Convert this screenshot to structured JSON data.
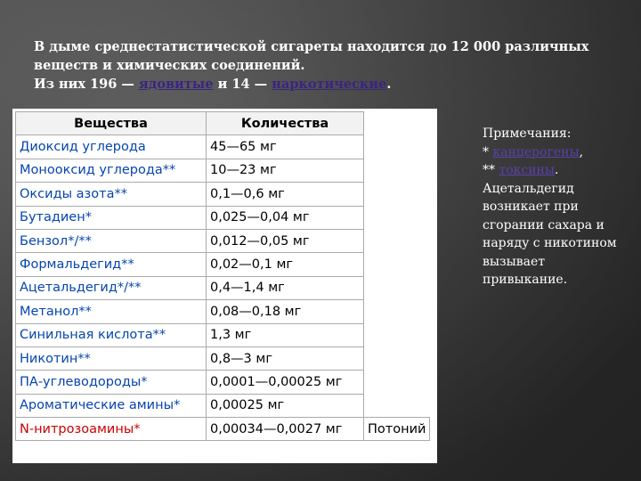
{
  "heading": {
    "line1": "В дыме среднестатистической сигареты находится до 12 000 различных",
    "line2": "веществ и химических соединений.",
    "line3_prefix": "Из них 196 — ",
    "link_toxic": "ядовитые",
    "line3_mid": " и 14 — ",
    "link_narcotic": "наркотические",
    "line3_suffix": "."
  },
  "table": {
    "headers": [
      "Вещества",
      "Количества"
    ],
    "rows": [
      {
        "name": "Диоксид углерода",
        "qty": "45—65 мг",
        "note": ""
      },
      {
        "name": "Монооксид углерода**",
        "qty": "10—23 мг",
        "note": ""
      },
      {
        "name": "Оксиды азота**",
        "qty": "0,1—0,6 мг",
        "note": ""
      },
      {
        "name": "Бутадиен*",
        "qty": "0,025—0,04 мг",
        "note": ""
      },
      {
        "name": "Бензол*/**",
        "qty": "0,012—0,05 мг",
        "note": ""
      },
      {
        "name": "Формальдегид**",
        "qty": "0,02—0,1 мг",
        "note": ""
      },
      {
        "name": "Ацетальдегид*/**",
        "qty": "0,4—1,4 мг",
        "note": ""
      },
      {
        "name": "Метанол**",
        "qty": "0,08—0,18 мг",
        "note": ""
      },
      {
        "name": "Синильная кислота**",
        "qty": "1,3 мг",
        "note": ""
      },
      {
        "name": "Никотин**",
        "qty": "0,8—3 мг",
        "note": ""
      },
      {
        "name": "ПА-углеводороды*",
        "qty": "0,0001—0,00025 мг",
        "note": ""
      },
      {
        "name": "Ароматические амины*",
        "qty": "0,00025 мг",
        "note": ""
      },
      {
        "name": "N-нитрозоамины*",
        "qty": "0,00034—0,0027 мг",
        "note": "Потоний"
      }
    ]
  },
  "notes": {
    "title": "Примечания:",
    "line1_prefix": "* ",
    "link_carcinogens": "канцерогены",
    "line1_suffix": ",",
    "line2_prefix": "** ",
    "link_toxins": "токсины",
    "line2_suffix": ".",
    "body": "Ацетальдегид возникает при сгорании сахара и наряду с никотином вызывает привыкание."
  },
  "colors": {
    "link_blue": "#0645ad",
    "link_red": "#cc0000",
    "link_purple": "#3a2580"
  }
}
